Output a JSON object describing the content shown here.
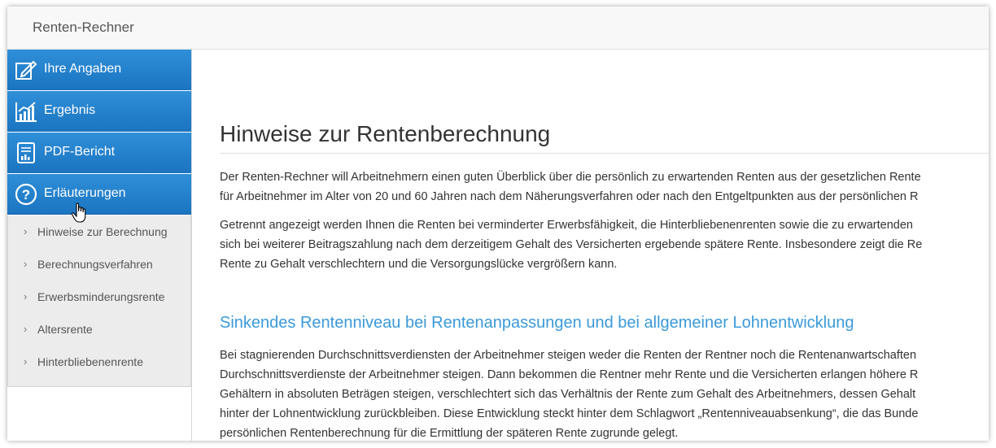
{
  "app": {
    "title": "Renten-Rechner"
  },
  "nav": {
    "items": [
      {
        "label": "Ihre Angaben",
        "icon": "edit-form-icon"
      },
      {
        "label": "Ergebnis",
        "icon": "bar-chart-icon"
      },
      {
        "label": "PDF-Bericht",
        "icon": "report-document-icon"
      },
      {
        "label": "Erläuterungen",
        "icon": "question-circle-icon"
      }
    ],
    "subitems": [
      "Hinweise zur Berechnung",
      "Berechnungsverfahren",
      "Erwerbsminderungsrente",
      "Altersrente",
      "Hinterbliebenenrente"
    ]
  },
  "main": {
    "title": "Hinweise zur Rentenberechnung",
    "paragraph1": [
      "Der Renten-Rechner will Arbeitnehmern einen guten Überblick über die persönlich zu erwartenden Renten aus der gesetzlichen Rente",
      "für Arbeitnehmer im Alter von 20 und 60 Jahren nach dem Näherungsverfahren oder nach den Entgeltpunkten aus der persönlichen R"
    ],
    "paragraph2": [
      "Getrennt angezeigt werden Ihnen die Renten bei verminderter Erwerbsfähigkeit, die Hinterbliebenenrenten sowie die zu erwartenden",
      "sich bei weiterer Beitragszahlung nach dem derzeitigem Gehalt des Versicherten ergebende spätere Rente. Insbesondere zeigt die Re",
      "Rente zu Gehalt verschlechtern und die Versorgungslücke vergrößern kann."
    ],
    "subheading": "Sinkendes Rentenniveau bei Rentenanpassungen und bei allgemeiner Lohnentwicklung",
    "paragraph3": [
      "Bei stagnierenden Durchschnittsverdiensten der Arbeitnehmer steigen weder die Renten der Rentner noch die Rentenanwartschaften",
      "Durchschnittsverdienste der Arbeitnehmer steigen. Dann bekommen die Rentner mehr Rente und die Versicherten erlangen höhere R",
      "Gehältern in absoluten Beträgen steigen, verschlechtert sich das Verhältnis der Rente zum Gehalt des Arbeitnehmers, dessen Gehalt",
      "hinter der Lohnentwicklung zurückbleiben. Diese Entwicklung steckt hinter dem Schlagwort „Rentenniveauabsenkung“, die das Bunde",
      "persönlichen Rentenberechnung für die Ermittlung der späteren Rente zugrunde gelegt."
    ]
  },
  "colors": {
    "nav_blue": "#1f7bc7",
    "subheading_blue": "#3a9ad9",
    "submenu_bg": "#ececec"
  }
}
